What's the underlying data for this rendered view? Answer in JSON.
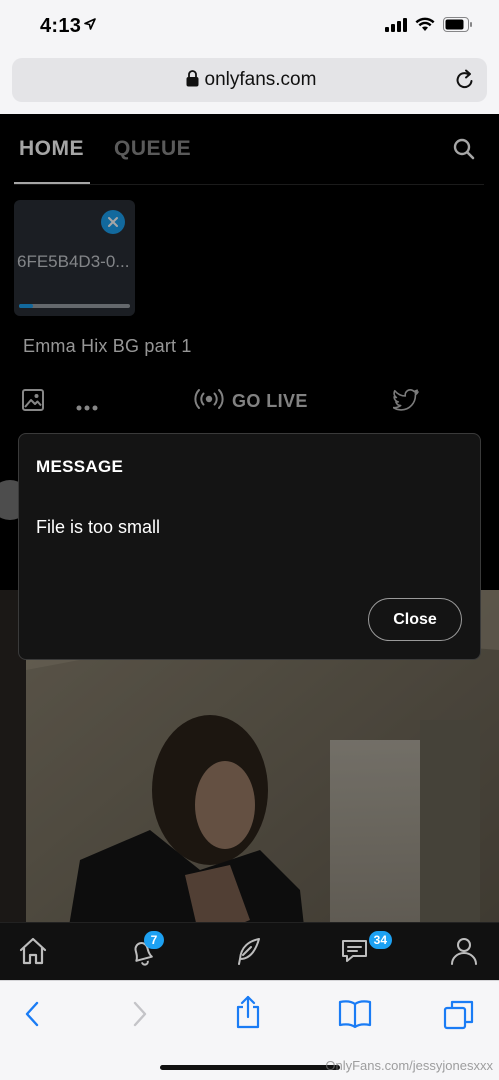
{
  "status_bar": {
    "time": "4:13",
    "icons": [
      "location-arrow-icon",
      "cellular-signal-icon",
      "wifi-icon",
      "battery-icon"
    ]
  },
  "browser": {
    "url": "onlyfans.com",
    "icons": [
      "lock-icon",
      "reload-icon"
    ]
  },
  "app": {
    "tabs": [
      {
        "label": "HOME",
        "active": true
      },
      {
        "label": "QUEUE",
        "active": false
      }
    ],
    "upload": {
      "file_name": "6FE5B4D3-0...",
      "progress": 0.13
    },
    "post_text": "Emma Hix BG part 1",
    "toolbar": {
      "go_live_label": "GO LIVE"
    },
    "nav": {
      "notifications_badge": "7",
      "messages_badge": "34"
    }
  },
  "modal": {
    "title": "MESSAGE",
    "body": "File is too small",
    "close_label": "Close"
  },
  "watermark": "OnlyFans.com/jessyjonesxxx",
  "colors": {
    "accent": "#1da1f2",
    "safari_blue": "#1a7cf5"
  }
}
